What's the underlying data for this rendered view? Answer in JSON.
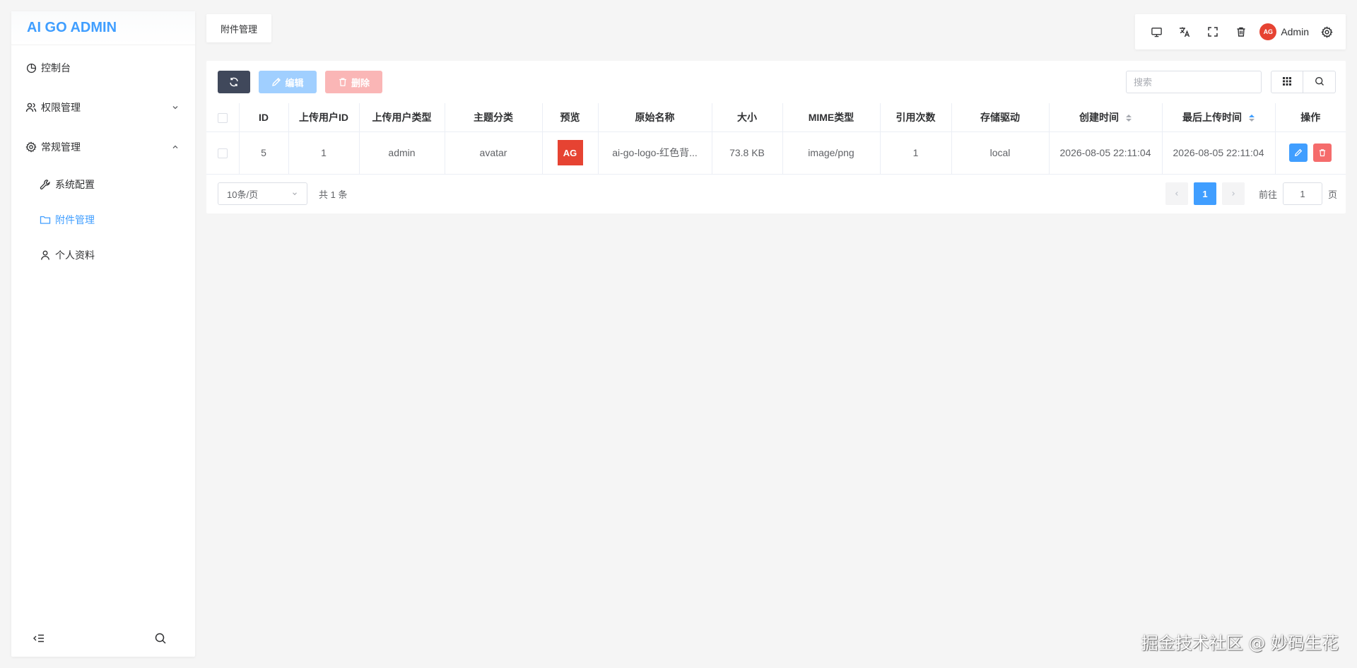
{
  "app": {
    "logo": "AI GO ADMIN",
    "accent": "#409eff"
  },
  "sidebar": {
    "items": [
      {
        "label": "控制台",
        "icon": "pie-chart-icon"
      },
      {
        "label": "权限管理",
        "icon": "users-icon",
        "expanded": false
      },
      {
        "label": "常规管理",
        "icon": "gear-icon",
        "expanded": true
      }
    ],
    "sub_items": [
      {
        "label": "系统配置",
        "icon": "wrench-icon"
      },
      {
        "label": "附件管理",
        "icon": "folder-icon",
        "active": true
      },
      {
        "label": "个人资料",
        "icon": "user-icon"
      }
    ]
  },
  "header": {
    "tab": "附件管理",
    "user": {
      "name": "Admin",
      "avatar_text": "AG"
    }
  },
  "toolbar": {
    "edit_label": "编辑",
    "delete_label": "删除",
    "search_placeholder": "搜索"
  },
  "table": {
    "columns": [
      "ID",
      "上传用户ID",
      "上传用户类型",
      "主题分类",
      "预览",
      "原始名称",
      "大小",
      "MIME类型",
      "引用次数",
      "存储驱动",
      "创建时间",
      "最后上传时间",
      "操作"
    ],
    "rows": [
      {
        "id": "5",
        "user_id": "1",
        "user_type": "admin",
        "topic": "avatar",
        "preview_text": "AG",
        "name": "ai-go-logo-红色背...",
        "size": "73.8 KB",
        "mime": "image/png",
        "refs": "1",
        "driver": "local",
        "created": "2026-08-05 22:11:04",
        "updated": "2026-08-05 22:11:04"
      }
    ]
  },
  "pagination": {
    "page_size": "10条/页",
    "total": "共 1 条",
    "current": "1",
    "goto_label": "前往",
    "goto_value": "1",
    "goto_suffix": "页"
  },
  "watermark": "掘金技术社区 @ 妙码生花"
}
